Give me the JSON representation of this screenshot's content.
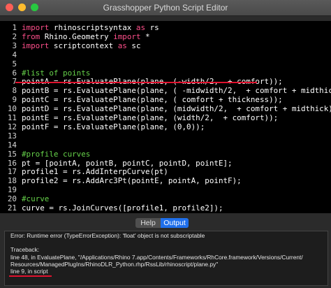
{
  "window": {
    "title": "Grasshopper Python Script Editor"
  },
  "editor": {
    "lines": [
      {
        "n": "1",
        "segments": [
          {
            "t": "import",
            "c": "kw"
          },
          {
            "t": " rhinoscriptsyntax "
          },
          {
            "t": "as",
            "c": "kw"
          },
          {
            "t": " rs"
          }
        ]
      },
      {
        "n": "2",
        "segments": [
          {
            "t": "from",
            "c": "kw"
          },
          {
            "t": " Rhino.Geometry "
          },
          {
            "t": "import",
            "c": "kw"
          },
          {
            "t": " *"
          }
        ]
      },
      {
        "n": "3",
        "segments": [
          {
            "t": "import",
            "c": "kw"
          },
          {
            "t": " scriptcontext "
          },
          {
            "t": "as",
            "c": "kw"
          },
          {
            "t": " sc"
          }
        ]
      },
      {
        "n": "4",
        "segments": []
      },
      {
        "n": "5",
        "segments": []
      },
      {
        "n": "6",
        "segments": [
          {
            "t": "#list of points",
            "c": "cm"
          }
        ]
      },
      {
        "n": "7",
        "segments": [
          {
            "t": "pointA = rs.EvaluatePlane(plane, (-width/2,  + comfort));"
          }
        ]
      },
      {
        "n": "8",
        "segments": [
          {
            "t": "pointB = rs.EvaluatePlane(plane, ( -midwidth/2,  + comfort + midthick));"
          }
        ]
      },
      {
        "n": "9",
        "segments": [
          {
            "t": "pointC = rs.EvaluatePlane(plane, ( comfort + thickness));"
          }
        ]
      },
      {
        "n": "10",
        "segments": [
          {
            "t": "pointD = rs.EvaluatePlane(plane, (midwidth/2,  + comfort + midthick));"
          }
        ]
      },
      {
        "n": "11",
        "segments": [
          {
            "t": "pointE = rs.EvaluatePlane(plane, (width/2,  + comfort));"
          }
        ]
      },
      {
        "n": "12",
        "segments": [
          {
            "t": "pointF = rs.EvaluatePlane(plane, (0,0));"
          }
        ]
      },
      {
        "n": "13",
        "segments": []
      },
      {
        "n": "14",
        "segments": []
      },
      {
        "n": "15",
        "segments": [
          {
            "t": "#profile curves",
            "c": "cm"
          }
        ]
      },
      {
        "n": "16",
        "segments": [
          {
            "t": "pt = [pointA, pointB, pointC, pointD, pointE];"
          }
        ]
      },
      {
        "n": "17",
        "segments": [
          {
            "t": "profile1 = rs.AddInterpCurve(pt)"
          }
        ]
      },
      {
        "n": "18",
        "segments": [
          {
            "t": "profile2 = rs.AddArc3Pt(pointE, pointA, pointF);"
          }
        ]
      },
      {
        "n": "19",
        "segments": []
      },
      {
        "n": "20",
        "segments": [
          {
            "t": "#curve",
            "c": "cm"
          }
        ]
      },
      {
        "n": "21",
        "segments": [
          {
            "t": "curve = rs.JoinCurves([profile1, profile2]);"
          }
        ]
      }
    ]
  },
  "tabs": {
    "help": "Help",
    "output": "Output"
  },
  "output": {
    "lines": [
      "Error: Runtime error (TypeErrorException): 'float' object is not subscriptable",
      "",
      "Traceback:",
      "  line 48, in EvaluatePlane, \"/Applications/Rhino 7.app/Contents/Frameworks/RhCore.framework/Versions/Current/",
      "Resources/ManagedPlugIns/RhinoDLR_Python.rhp/RssLib/rhinoscript/plane.py\"",
      "  line 9, in script"
    ]
  }
}
